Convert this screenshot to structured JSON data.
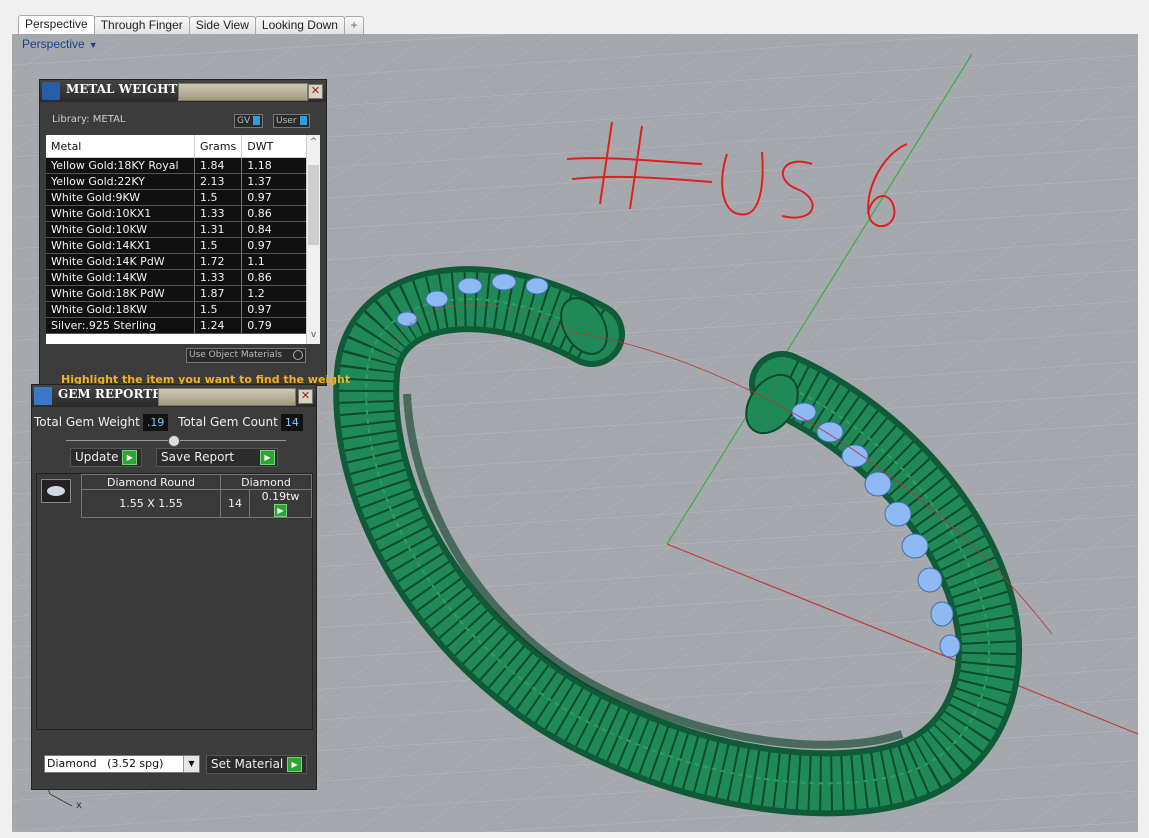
{
  "tabs": [
    "Perspective",
    "Through Finger",
    "Side View",
    "Looking Down",
    "+"
  ],
  "viewport": {
    "label": "Perspective",
    "dropdown_glyph": "▼"
  },
  "annotation": "# US 6",
  "axis_label": "x",
  "metal_weights": {
    "title": "METAL WEIGHTS",
    "close": "✕",
    "library_label": "Library: METAL",
    "gv_label": "GV",
    "user_label": "User",
    "columns": [
      "Metal",
      "Grams",
      "DWT"
    ],
    "rows": [
      [
        "Yellow Gold:18KY Royal",
        "1.84",
        "1.18"
      ],
      [
        "Yellow Gold:22KY",
        "2.13",
        "1.37"
      ],
      [
        "White Gold:9KW",
        "1.5",
        "0.97"
      ],
      [
        "White Gold:10KX1",
        "1.33",
        "0.86"
      ],
      [
        "White Gold:10KW",
        "1.31",
        "0.84"
      ],
      [
        "White Gold:14KX1",
        "1.5",
        "0.97"
      ],
      [
        "White Gold:14K PdW",
        "1.72",
        "1.1"
      ],
      [
        "White Gold:14KW",
        "1.33",
        "0.86"
      ],
      [
        "White Gold:18K PdW",
        "1.87",
        "1.2"
      ],
      [
        "White Gold:18KW",
        "1.5",
        "0.97"
      ],
      [
        "Silver:.925 Sterling",
        "1.24",
        "0.79"
      ]
    ],
    "use_object_materials": "Use Object Materials",
    "hint": "Highlight the item you want to find the weight"
  },
  "gem_reporter": {
    "title": "GEM REPORTER",
    "close": "✕",
    "total_weight_label": "Total Gem Weight",
    "total_weight_value": ".19",
    "total_count_label": "Total Gem Count",
    "total_count_value": "14",
    "update_label": "Update",
    "save_report_label": "Save Report",
    "gem_row": {
      "name": "Diamond Round",
      "size": "1.55 X 1.55",
      "material": "Diamond",
      "count": "14",
      "weight": "0.19tw"
    },
    "material_select": "Diamond   (3.52 spg)",
    "set_material_label": "Set Material"
  },
  "colors": {
    "viewport_bg": "#a4a8ad",
    "ring_green": "#1d7a4e",
    "gem_blue": "#8fb9f2",
    "annotation_red": "#e02020",
    "panel_bg": "#3c3c3c",
    "accent_green": "#2fa335"
  }
}
